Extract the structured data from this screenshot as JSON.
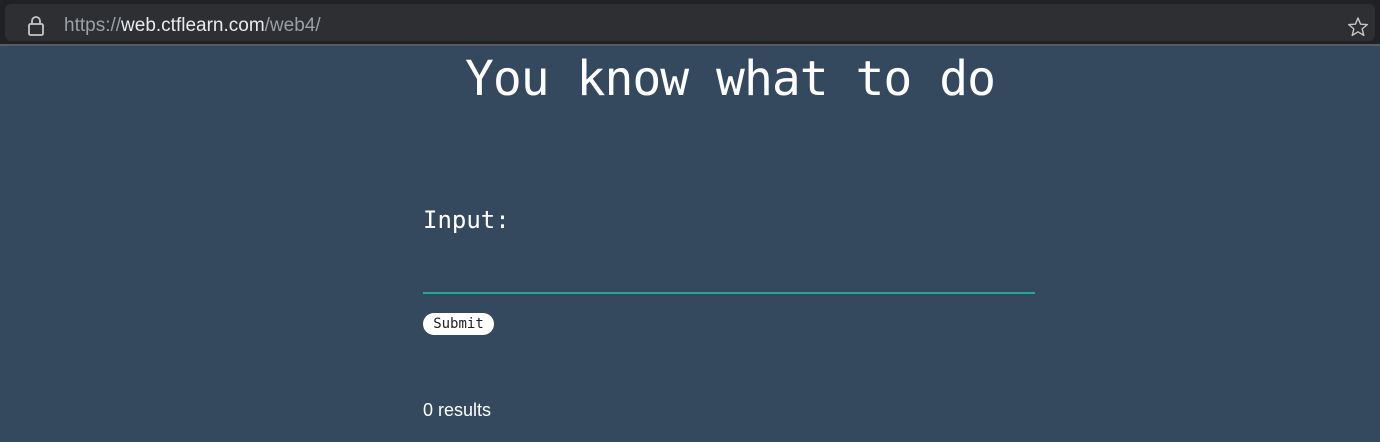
{
  "browser": {
    "url_scheme": "https://",
    "url_host": "web.ctflearn.com",
    "url_path": "/web4/",
    "lock_icon": "lock-icon",
    "bookmark_icon": "star-outline-icon"
  },
  "page": {
    "title": "You know what to do",
    "input_label": "Input:",
    "input_value": "",
    "submit_label": "Submit",
    "results_text": "0 results"
  },
  "colors": {
    "background": "#35495e",
    "input_underline": "#26a69a",
    "browser_bar": "#202124"
  }
}
